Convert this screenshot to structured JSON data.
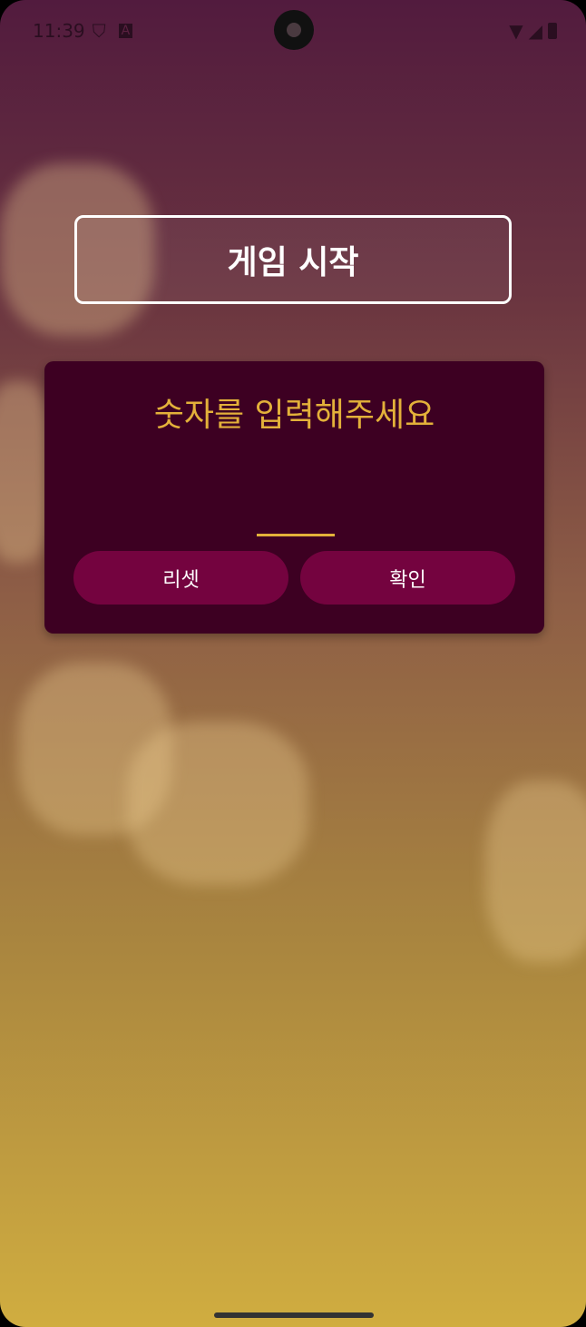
{
  "status_bar": {
    "time": "11:39"
  },
  "start_button": {
    "label": "게임 시작"
  },
  "card": {
    "prompt": "숫자를 입력해주세요",
    "input_value": "",
    "reset_label": "리셋",
    "confirm_label": "확인"
  }
}
